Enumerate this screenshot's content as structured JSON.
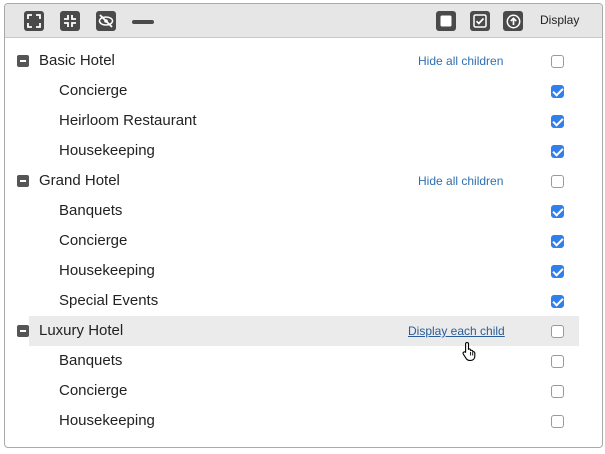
{
  "toolbar": {
    "icons": [
      "expand-icon",
      "collapse-icon",
      "hide-eye-icon",
      "minus-icon",
      "empty-square-icon",
      "checked-square-icon",
      "up-arrow-circle-icon"
    ],
    "display_label": "Display"
  },
  "rows": [
    {
      "kind": "parent",
      "label": "Basic Hotel",
      "link": "Hide all children",
      "checked": false
    },
    {
      "kind": "child",
      "label": "Concierge",
      "checked": true
    },
    {
      "kind": "child",
      "label": "Heirloom Restaurant",
      "checked": true
    },
    {
      "kind": "child",
      "label": "Housekeeping",
      "checked": true
    },
    {
      "kind": "parent",
      "label": "Grand Hotel",
      "link": "Hide all children",
      "checked": false
    },
    {
      "kind": "child",
      "label": "Banquets",
      "checked": true
    },
    {
      "kind": "child",
      "label": "Concierge",
      "checked": true
    },
    {
      "kind": "child",
      "label": "Housekeeping",
      "checked": true
    },
    {
      "kind": "child",
      "label": "Special Events",
      "checked": true
    },
    {
      "kind": "parent",
      "label": "Luxury Hotel",
      "link": "Display each child",
      "checked": false,
      "hovered": true
    },
    {
      "kind": "child",
      "label": "Banquets",
      "checked": false
    },
    {
      "kind": "child",
      "label": "Concierge",
      "checked": false
    },
    {
      "kind": "child",
      "label": "Housekeeping",
      "checked": false
    }
  ],
  "colors": {
    "accent": "#2f80ed",
    "link": "#2f6fb0",
    "toolbar_bg": "#e6e6e6",
    "hover_bg": "#ebebeb"
  }
}
